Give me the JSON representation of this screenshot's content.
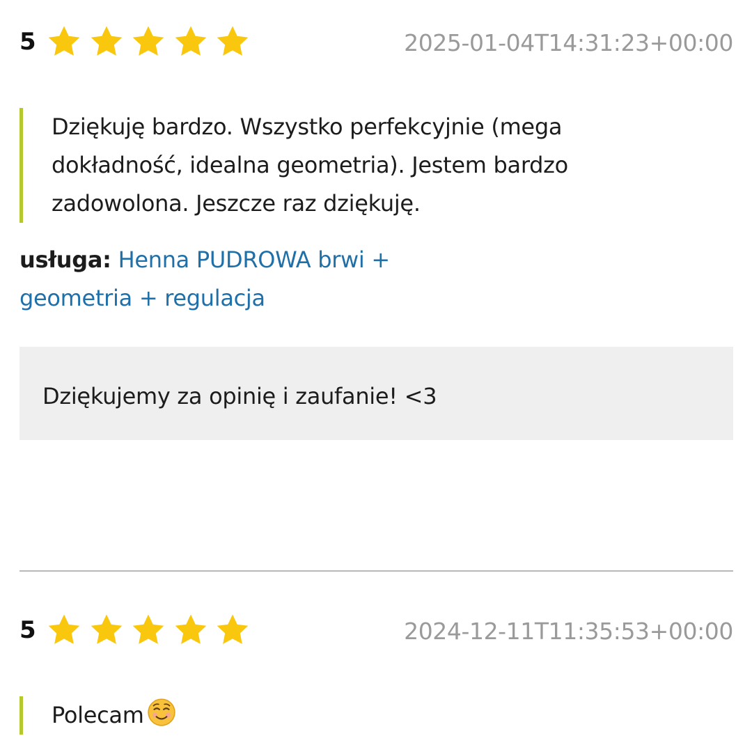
{
  "reviews": [
    {
      "rating": "5",
      "stars_filled": 5,
      "stars_total": 5,
      "timestamp": "2025-01-04T14:31:23+00:00",
      "text": "Dziękuję bardzo. Wszystko perfekcyjnie (mega dokładność, idealna geometria). Jestem bardzo zadowolona. Jeszcze raz dziękuję.",
      "service_label": "usługa:",
      "service_name": "Henna PUDROWA brwi + geometria + regulacja",
      "reply": "Dziękujemy za opinię i zaufanie! <3"
    },
    {
      "rating": "5",
      "stars_filled": 5,
      "stars_total": 5,
      "timestamp": "2024-12-11T11:35:53+00:00",
      "text": "Polecam",
      "emoji": "smiling-face-icon"
    }
  ],
  "colors": {
    "star": "#f9c80e",
    "accent_border": "#b5c92e",
    "link": "#1f6fa8",
    "timestamp": "#9a9a9a",
    "reply_background": "#efefef",
    "divider": "#b8b8b8"
  }
}
